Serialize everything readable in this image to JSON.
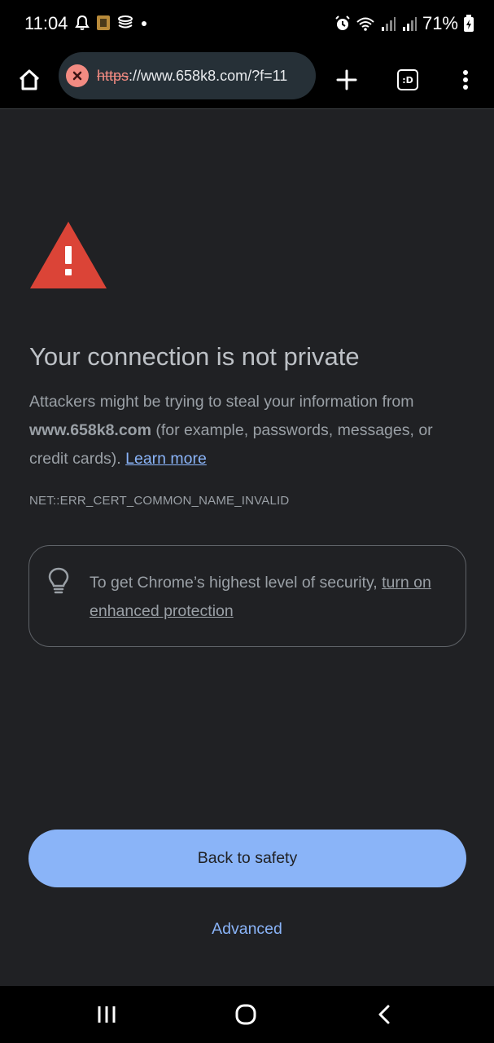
{
  "status_bar": {
    "time": "11:04",
    "battery": "71%",
    "left_icons": [
      "bell-icon",
      "app-notification-icon",
      "stack-icon",
      "dot-icon"
    ],
    "right_icons": [
      "alarm-icon",
      "wifi-icon",
      "signal-icon",
      "signal-icon",
      "battery-charging-icon"
    ]
  },
  "toolbar": {
    "url_scheme": "https",
    "url_rest": "://www.658k8.com/?f=11",
    "tabs_label": ":D",
    "icons": [
      "home-icon",
      "not-secure-icon",
      "plus-icon",
      "tab-switcher-icon",
      "more-vert-icon"
    ]
  },
  "interstitial": {
    "title": "Your connection is not private",
    "message_before": "Attackers might be trying to steal your information from ",
    "domain": "www.658k8.com",
    "message_after": " (for example, passwords, messages, or credit cards). ",
    "learn_more": "Learn more",
    "error_code": "NET::ERR_CERT_COMMON_NAME_INVALID",
    "enhanced_text": "To get Chrome’s highest level of security, ",
    "enhanced_link": "turn on enhanced protection",
    "back_button": "Back to safety",
    "advanced_button": "Advanced"
  },
  "colors": {
    "background": "#202124",
    "accent": "#8ab4f8",
    "warning_red": "#db4437",
    "not_secure": "#f28b82"
  },
  "nav_bar": {
    "buttons": [
      "recents-icon",
      "home-circle-icon",
      "back-icon"
    ]
  }
}
